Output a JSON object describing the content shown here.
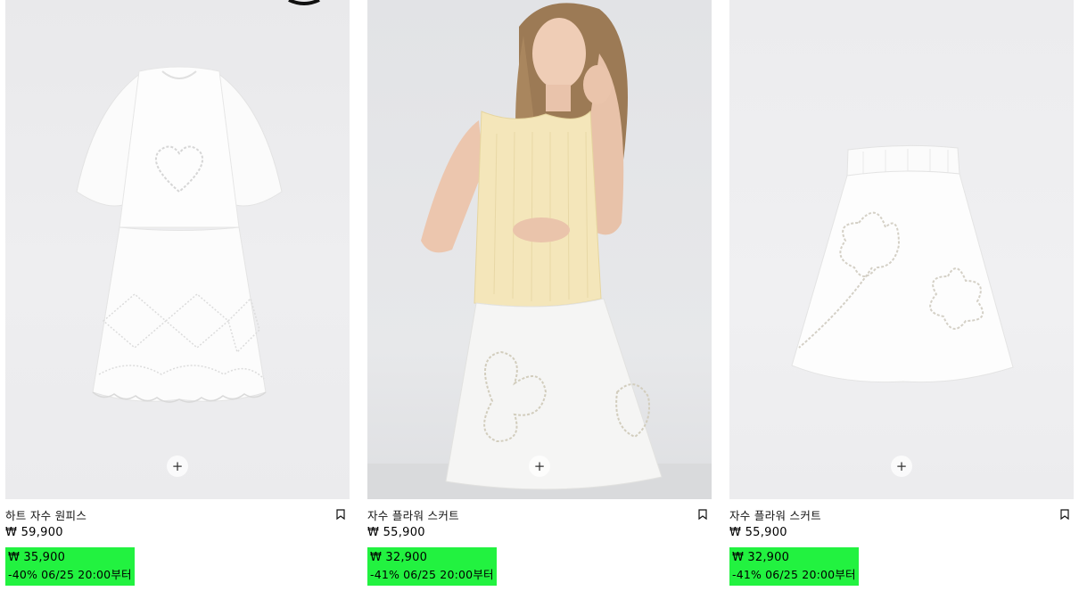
{
  "products": [
    {
      "name": "하트 자수 원피스",
      "image": "white-embroidered-dress",
      "price": "₩ 59,900",
      "sale_price": "₩ 35,900",
      "discount": "-40%",
      "sale_from": "06/25 20:00부터"
    },
    {
      "name": "자수 플라워 스커트",
      "image": "model-yellow-top-white-skirt",
      "price": "₩ 55,900",
      "sale_price": "₩ 32,900",
      "discount": "-41%",
      "sale_from": "06/25 20:00부터"
    },
    {
      "name": "자수 플라워 스커트",
      "image": "white-flower-skirt",
      "price": "₩ 55,900",
      "sale_price": "₩ 32,900",
      "discount": "-41%",
      "sale_from": "06/25 20:00부터"
    }
  ],
  "icons": {
    "quick_add": "+",
    "bookmark": "bookmark-icon"
  },
  "colors": {
    "sale_highlight": "#22f240"
  }
}
